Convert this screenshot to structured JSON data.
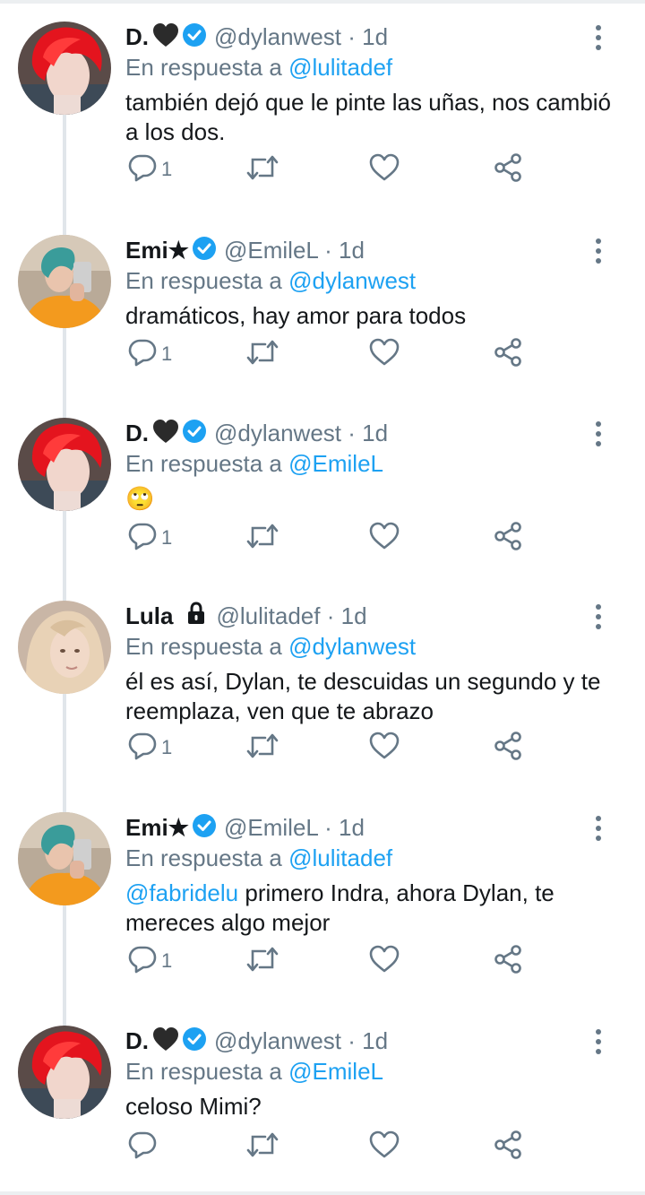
{
  "tweets": [
    {
      "avatar": "red-hair-avatar",
      "name": "D.",
      "heart": true,
      "verified": true,
      "lock": false,
      "handle": "@dylanwest",
      "dot": "·",
      "time": "1d",
      "reply_prefix": "En respuesta a",
      "reply_handle": "@lulitadef",
      "mention": "",
      "text": "también dejó que le pinte las uñas, nos cambió a los dos.",
      "reply_count": "1"
    },
    {
      "avatar": "teal-hair-avatar",
      "name": "Emi★",
      "heart": false,
      "verified": true,
      "lock": false,
      "handle": "@EmileL",
      "dot": "·",
      "time": "1d",
      "reply_prefix": "En respuesta a",
      "reply_handle": "@dylanwest",
      "mention": "",
      "text": "dramáticos, hay amor para todos",
      "reply_count": "1"
    },
    {
      "avatar": "red-hair-avatar",
      "name": "D.",
      "heart": true,
      "verified": true,
      "lock": false,
      "handle": "@dylanwest",
      "dot": "·",
      "time": "1d",
      "reply_prefix": "En respuesta a",
      "reply_handle": "@EmileL",
      "mention": "",
      "text": "🙄",
      "reply_count": "1"
    },
    {
      "avatar": "blonde-hair-avatar",
      "name": "Lula",
      "heart": false,
      "verified": false,
      "lock": true,
      "handle": "@lulitadef",
      "dot": "·",
      "time": "1d",
      "reply_prefix": "En respuesta a",
      "reply_handle": "@dylanwest",
      "mention": "",
      "text": "él es así, Dylan, te descuidas un segundo y te reemplaza, ven que te abrazo",
      "reply_count": "1"
    },
    {
      "avatar": "teal-hair-avatar",
      "name": "Emi★",
      "heart": false,
      "verified": true,
      "lock": false,
      "handle": "@EmileL",
      "dot": "·",
      "time": "1d",
      "reply_prefix": "En respuesta a",
      "reply_handle": "@lulitadef",
      "mention": "@fabridelu",
      "text": " primero Indra, ahora Dylan, te mereces algo mejor",
      "reply_count": "1"
    },
    {
      "avatar": "red-hair-avatar",
      "name": "D.",
      "heart": true,
      "verified": true,
      "lock": false,
      "handle": "@dylanwest",
      "dot": "·",
      "time": "1d",
      "reply_prefix": "En respuesta a",
      "reply_handle": "@EmileL",
      "mention": "",
      "text": "celoso Mimi?",
      "reply_count": ""
    }
  ],
  "colors": {
    "link": "#1da1f2",
    "muted": "#657786",
    "verified": "#1da1f2",
    "thread_line": "#e1e6ea"
  },
  "icons": [
    "reply-icon",
    "retweet-icon",
    "like-icon",
    "share-icon",
    "more-options-icon",
    "verified-icon",
    "black-heart-icon",
    "lock-icon"
  ]
}
